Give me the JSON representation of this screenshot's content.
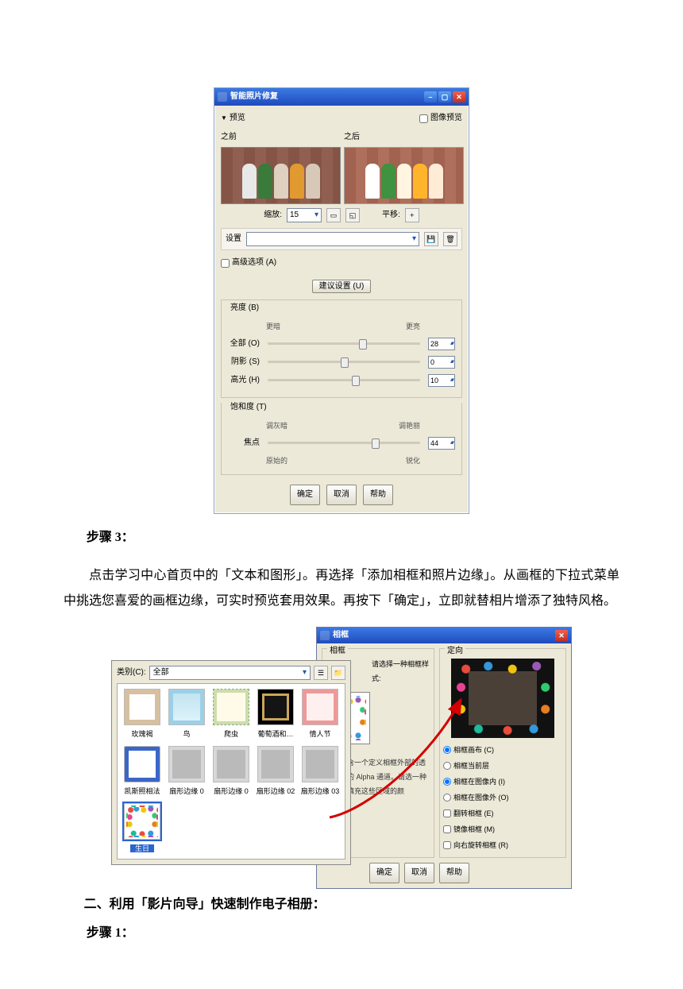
{
  "dialog1": {
    "title": "智能照片修复",
    "preview_toggle": "预览",
    "image_preview_chk": "图像预览",
    "before_label": "之前",
    "after_label": "之后",
    "zoom_label": "缩放:",
    "zoom_value": "15",
    "pan_label": "平移:",
    "pan_value": "+",
    "settings_label": "设置",
    "advanced_chk": "高级选项 (A)",
    "suggest_btn": "建议设置 (U)",
    "brightness_group": "亮度 (B)",
    "darker": "更暗",
    "lighter": "更亮",
    "sliders": {
      "all": {
        "label": "全部 (O)",
        "value": "28"
      },
      "shadow": {
        "label": "阴影 (S)",
        "value": "0"
      },
      "high": {
        "label": "高光 (H)",
        "value": "10"
      }
    },
    "saturation_group": "饱和度 (T)",
    "sat_left": "调灰暗",
    "sat_right": "调艳丽",
    "focus_label": "焦点",
    "focus_value": "44",
    "focus_left": "原始的",
    "focus_right": "锐化",
    "ok": "确定",
    "cancel": "取消",
    "help": "帮助"
  },
  "body": {
    "step3_title": "步骤 3：",
    "step3_text": "点击学习中心首页中的「文本和图形」。再选择「添加相框和照片边缘」。从画框的下拉式菜单中挑选您喜爱的画框边缘，可实时预览套用效果。再按下「确定」，立即就替相片增添了独特风格。",
    "sec2_title": "二、利用「影片向导」快速制作电子相册：",
    "step1_title": "步骤  1："
  },
  "dialog2": {
    "title": "相框",
    "left_legend": "相框",
    "style_prompt": "请选择一种相框样式:",
    "note": "相框包含一个定义相框外部的透明区域的 Alpha 通道。请选一种要用来填充这些区域的颜",
    "right_legend": "定向",
    "radios": {
      "r1": "相框画布 (C)",
      "r2": "相框当前层",
      "r3": "相框在图像内 (I)",
      "r4": "相框在图像外 (O)"
    },
    "checks": {
      "c1": "翻转相框 (E)",
      "c2": "镜像相框 (M)",
      "c3": "向右旋转相框 (R)"
    },
    "ok": "确定",
    "cancel": "取消",
    "help": "帮助"
  },
  "catpicker": {
    "category_label": "类别(C):",
    "category_value": "全部",
    "items": [
      "玫瑰褐",
      "鸟",
      "爬虫",
      "葡萄酒和…",
      "情人节",
      "凯斯照相法",
      "扇形边缘 0",
      "扇形边缘 0",
      "扇形边缘 02",
      "扇形边缘 03",
      "生日"
    ]
  }
}
